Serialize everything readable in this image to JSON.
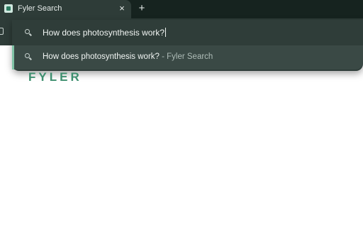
{
  "tab": {
    "title": "Fyler Search",
    "close_glyph": "×"
  },
  "new_tab_glyph": "+",
  "omnibox": {
    "input_value": "How does photosynthesis work?",
    "suggestion_query": "How does photosynthesis work?",
    "suggestion_source": " - Fyler Search"
  },
  "logo": {
    "text": "FYLER"
  },
  "colors": {
    "tabstrip": "#16231f",
    "toolbar": "#2e3c38",
    "accent": "#3e8f6f",
    "selection_bar": "#7fc2a5"
  }
}
